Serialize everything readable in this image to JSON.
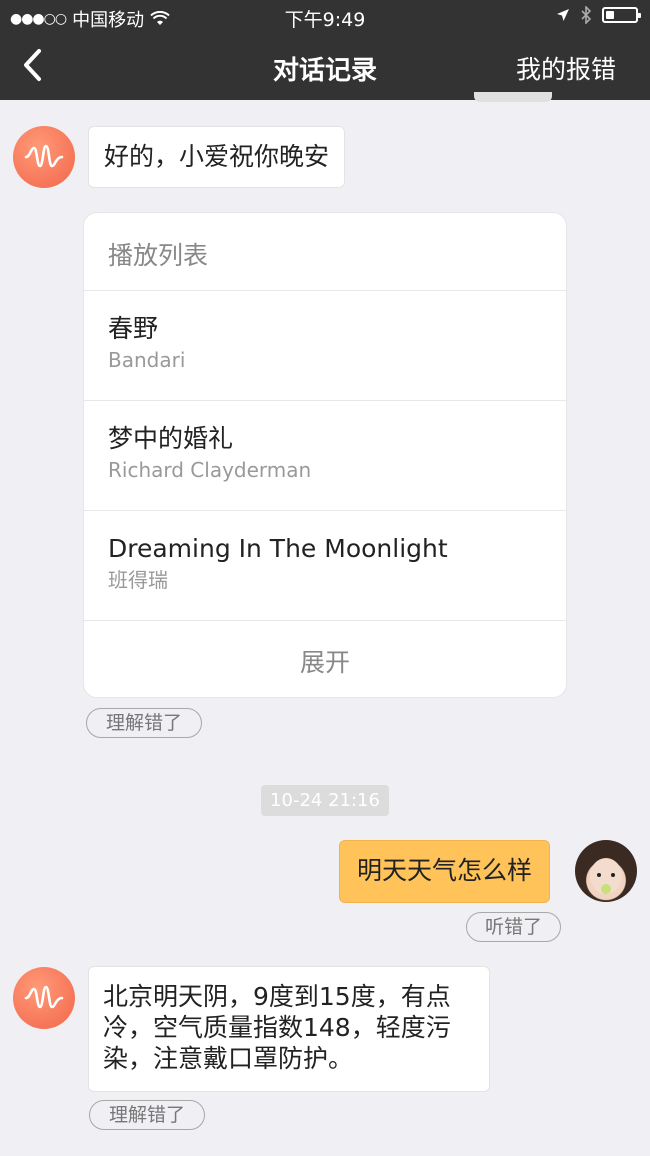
{
  "status_bar": {
    "carrier": "中国移动",
    "time": "下午9:49"
  },
  "nav": {
    "title": "对话记录",
    "report": "我的报错"
  },
  "messages": {
    "ai_1": "好的，小爱祝你晚安",
    "playlist": {
      "header": "播放列表",
      "tracks": [
        {
          "title": "春野",
          "artist": "Bandari"
        },
        {
          "title": "梦中的婚礼",
          "artist": "Richard Clayderman"
        },
        {
          "title": "Dreaming In The Moonlight",
          "artist": "班得瑞"
        }
      ],
      "expand": "展开"
    },
    "misunderstood_1": "理解错了",
    "timestamp": "10-24 21:16",
    "user_1": "明天天气怎么样",
    "misheard": "听错了",
    "ai_2": "北京明天阴，9度到15度，有点冷，空气质量指数148，轻度污染，注意戴口罩防护。",
    "misunderstood_2": "理解错了"
  },
  "colors": {
    "nav_bg": "#333334",
    "ai_avatar": "#f2654a",
    "user_bubble": "#ffc35a",
    "page_bg": "#efeff4"
  },
  "icons": {
    "back": "chevron-left-icon",
    "wifi": "wifi-icon",
    "location": "location-arrow-icon",
    "bluetooth": "bluetooth-icon",
    "battery": "battery-icon",
    "ai_avatar": "waveform-icon"
  },
  "battery_level": 0.3
}
